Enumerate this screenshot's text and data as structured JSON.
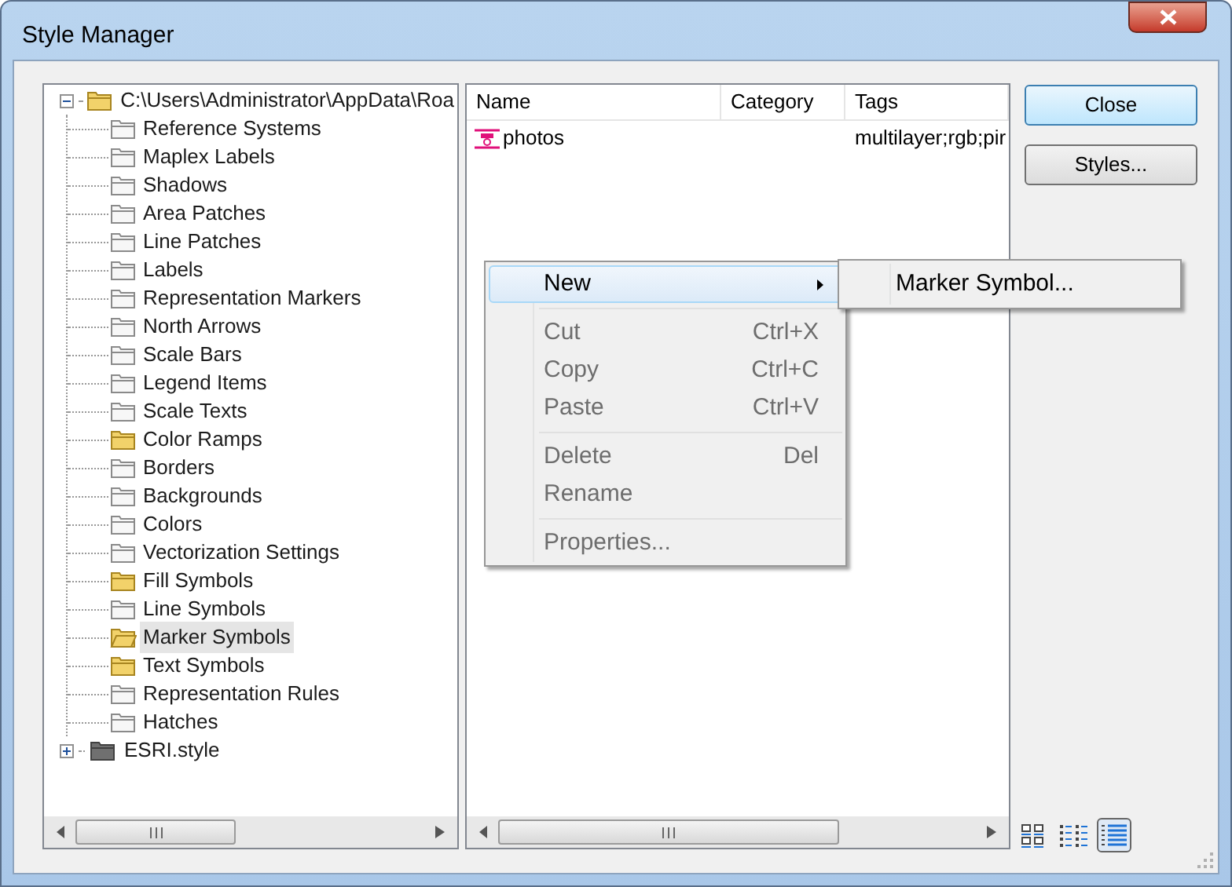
{
  "window": {
    "title": "Style Manager"
  },
  "tree": [
    {
      "label": "C:\\Users\\Administrator\\AppData\\Roa",
      "expanded": true,
      "kind": "folder",
      "selected": false,
      "children": [
        {
          "label": "Reference Systems",
          "has_items": false,
          "selected": false
        },
        {
          "label": "Maplex Labels",
          "has_items": false,
          "selected": false
        },
        {
          "label": "Shadows",
          "has_items": false,
          "selected": false
        },
        {
          "label": "Area Patches",
          "has_items": false,
          "selected": false
        },
        {
          "label": "Line Patches",
          "has_items": false,
          "selected": false
        },
        {
          "label": "Labels",
          "has_items": false,
          "selected": false
        },
        {
          "label": "Representation Markers",
          "has_items": false,
          "selected": false
        },
        {
          "label": "North Arrows",
          "has_items": false,
          "selected": false
        },
        {
          "label": "Scale Bars",
          "has_items": false,
          "selected": false
        },
        {
          "label": "Legend Items",
          "has_items": false,
          "selected": false
        },
        {
          "label": "Scale Texts",
          "has_items": false,
          "selected": false
        },
        {
          "label": "Color Ramps",
          "has_items": true,
          "selected": false
        },
        {
          "label": "Borders",
          "has_items": false,
          "selected": false
        },
        {
          "label": "Backgrounds",
          "has_items": false,
          "selected": false
        },
        {
          "label": "Colors",
          "has_items": false,
          "selected": false
        },
        {
          "label": "Vectorization Settings",
          "has_items": false,
          "selected": false
        },
        {
          "label": "Fill Symbols",
          "has_items": true,
          "selected": false
        },
        {
          "label": "Line Symbols",
          "has_items": false,
          "selected": false
        },
        {
          "label": "Marker Symbols",
          "has_items": true,
          "selected": true
        },
        {
          "label": "Text Symbols",
          "has_items": true,
          "selected": false
        },
        {
          "label": "Representation Rules",
          "has_items": false,
          "selected": false
        },
        {
          "label": "Hatches",
          "has_items": false,
          "selected": false
        }
      ]
    },
    {
      "label": "ESRI.style",
      "expanded": false,
      "kind": "style",
      "selected": false
    }
  ],
  "list": {
    "columns": [
      "Name",
      "Category",
      "Tags"
    ],
    "rows": [
      {
        "name": "photos",
        "category": "",
        "tags": "multilayer;rgb;pir"
      }
    ]
  },
  "buttons": [
    "Close",
    "Styles..."
  ],
  "context_menu": [
    {
      "kind": "item",
      "label": "New",
      "highlighted": true,
      "disabled": false,
      "submenu": true
    },
    {
      "kind": "separator"
    },
    {
      "kind": "item",
      "label": "Cut",
      "shortcut": "Ctrl+X",
      "highlighted": false,
      "disabled": true,
      "submenu": false
    },
    {
      "kind": "item",
      "label": "Copy",
      "shortcut": "Ctrl+C",
      "highlighted": false,
      "disabled": true,
      "submenu": false
    },
    {
      "kind": "item",
      "label": "Paste",
      "shortcut": "Ctrl+V",
      "highlighted": false,
      "disabled": true,
      "submenu": false
    },
    {
      "kind": "separator"
    },
    {
      "kind": "item",
      "label": "Delete",
      "shortcut": "Del",
      "highlighted": false,
      "disabled": true,
      "submenu": false
    },
    {
      "kind": "item",
      "label": "Rename",
      "highlighted": false,
      "disabled": true,
      "submenu": false
    },
    {
      "kind": "separator"
    },
    {
      "kind": "item",
      "label": "Properties...",
      "highlighted": false,
      "disabled": true,
      "submenu": false
    }
  ],
  "submenu": [
    {
      "label": "Marker Symbol..."
    }
  ],
  "view_buttons": [
    {
      "kind": "icons",
      "selected": false
    },
    {
      "kind": "list",
      "selected": false
    },
    {
      "kind": "details",
      "selected": true
    }
  ]
}
